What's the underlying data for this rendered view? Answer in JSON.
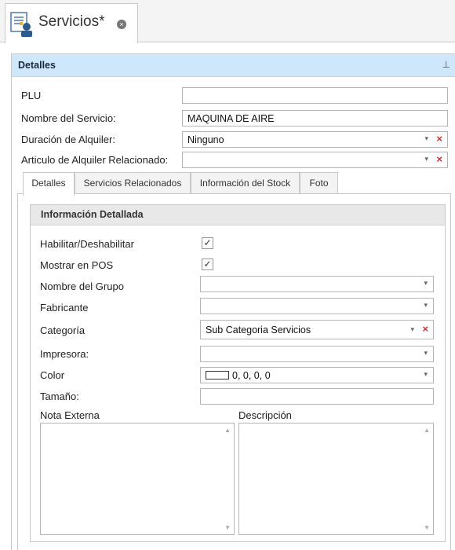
{
  "document_tab": {
    "title": "Servicios*",
    "icon": "services-form-icon"
  },
  "panel": {
    "title": "Detalles",
    "pin_icon": "pin-icon"
  },
  "form": {
    "plu_label": "PLU",
    "plu_value": "",
    "service_name_label": "Nombre del Servicio:",
    "service_name_value": "MAQUINA DE AIRE",
    "rental_duration_label": "Duración de Alquiler:",
    "rental_duration_value": "Ninguno",
    "related_rental_label": "Articulo de Alquiler  Relacionado:",
    "related_rental_value": ""
  },
  "inner_tabs": [
    "Detalles",
    "Servicios Relacionados",
    "Información del Stock",
    "Foto"
  ],
  "active_tab": "Detalles",
  "group": {
    "title": "Información Detallada",
    "enable_label": "Habilitar/Deshabilitar",
    "enable_checked": true,
    "show_pos_label": "Mostrar en POS",
    "show_pos_checked": true,
    "group_name_label": "Nombre del Grupo",
    "group_name_value": "",
    "manufacturer_label": "Fabricante",
    "manufacturer_value": "",
    "category_label": "Categoría",
    "category_value": "Sub Categoria  Servicios",
    "printer_label": "Impresora:",
    "printer_value": "",
    "color_label": "Color",
    "color_value": "0, 0, 0, 0",
    "size_label": "Tamaño:",
    "size_value": "",
    "external_note_label": "Nota Externa",
    "description_label": "Descripción"
  },
  "glyphs": {
    "dropdown": "▾",
    "clear": "×",
    "check": "✓",
    "close": "×",
    "pin": "⊥",
    "scroll_up": "▲",
    "scroll_down": "▼"
  },
  "colors": {
    "header_blue": "#cfe7fb",
    "clear_red": "#e0262b",
    "group_header": "#e8e8e8"
  }
}
